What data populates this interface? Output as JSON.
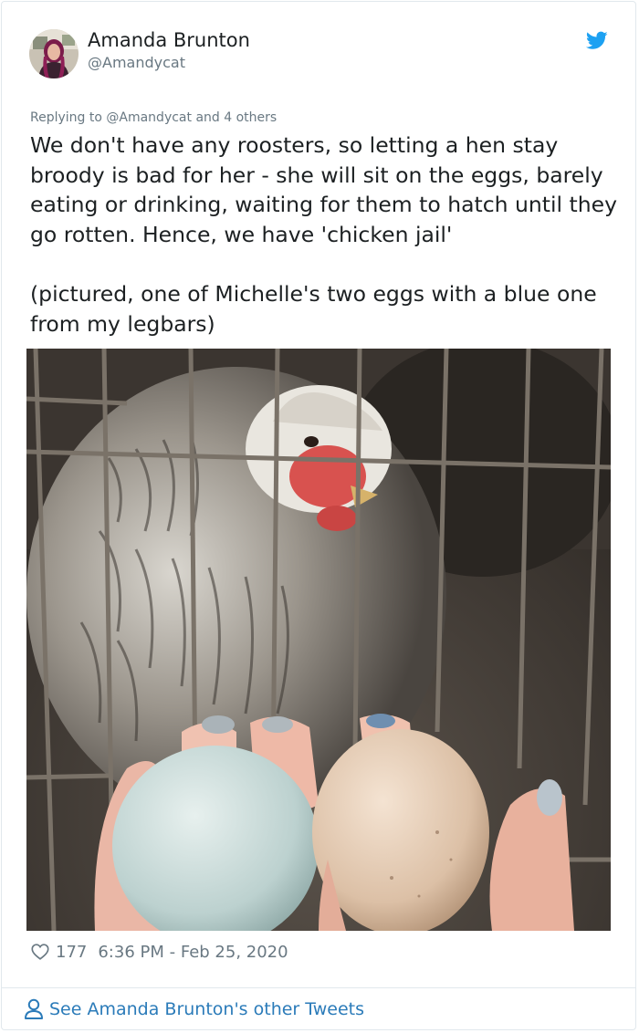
{
  "author": {
    "display_name": "Amanda Brunton",
    "handle": "@Amandycat",
    "avatar_icon": "avatar-photo"
  },
  "brand_icon": "twitter-bird-icon",
  "colors": {
    "brand": "#1da1f2",
    "link": "#2b7bb9",
    "muted": "#697882",
    "text": "#1c2022",
    "border": "#e1e8ed"
  },
  "reply": {
    "prefix": "Replying to",
    "mention": "@Amandycat",
    "suffix": "and 4 others"
  },
  "tweet": {
    "paragraph_1": "We don't have any roosters, so letting a hen stay broody is bad for her - she will sit on the eggs, barely eating or drinking, waiting for them to hatch until they go rotten. Hence, we have 'chicken jail'",
    "paragraph_2": "(pictured, one of Michelle's two eggs with a blue one from my legbars)"
  },
  "media": {
    "type": "photo"
  },
  "meta": {
    "likes": "177",
    "timestamp": "6:36 PM - Feb 25, 2020"
  },
  "footer": {
    "label": "See Amanda Brunton's other Tweets"
  }
}
